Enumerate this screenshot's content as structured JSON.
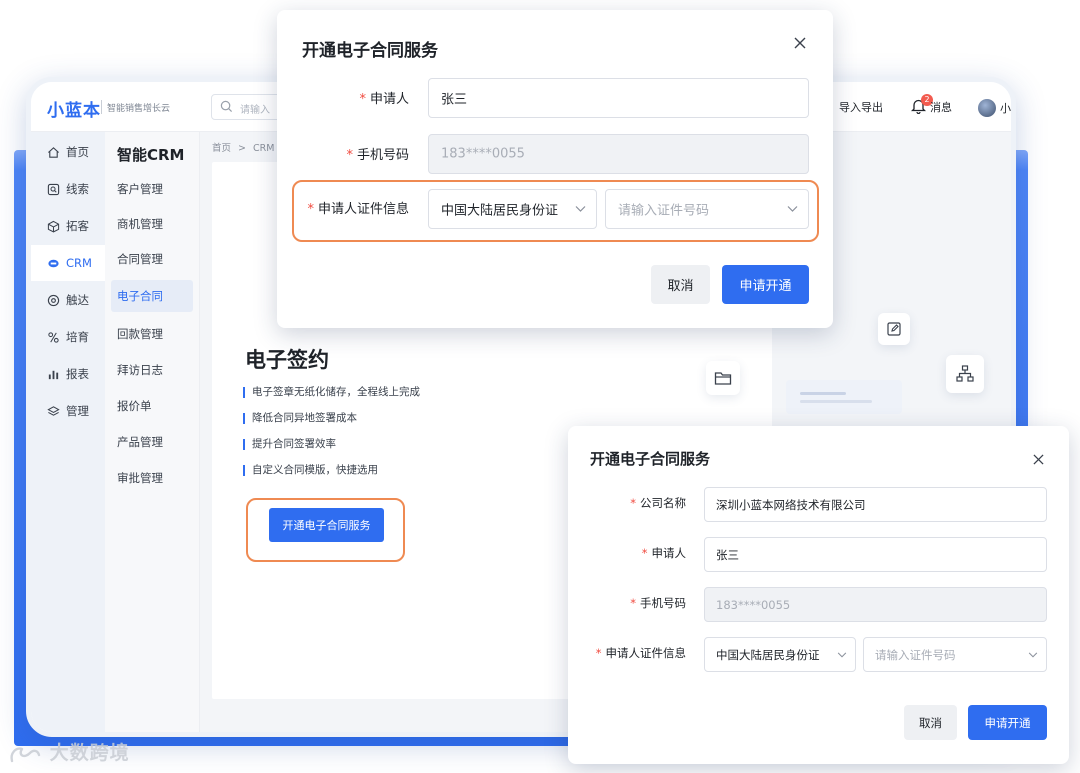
{
  "app": {
    "logo": "小蓝本",
    "tagline": "智能销售增长云"
  },
  "topbar": {
    "search_placeholder": "请输入",
    "import_export": "导入导出",
    "notification_count": "2",
    "messages": "消息",
    "user_initial": "小"
  },
  "sidebar": {
    "items": [
      {
        "label": "首页",
        "icon": "home-icon"
      },
      {
        "label": "线索",
        "icon": "clue-icon"
      },
      {
        "label": "拓客",
        "icon": "cube-icon"
      },
      {
        "label": "CRM",
        "icon": "crm-icon"
      },
      {
        "label": "触达",
        "icon": "reach-icon"
      },
      {
        "label": "培育",
        "icon": "nurture-icon"
      },
      {
        "label": "报表",
        "icon": "bar-chart-icon"
      },
      {
        "label": "管理",
        "icon": "layers-icon"
      }
    ],
    "active_index": 3
  },
  "subnav": {
    "title": "智能CRM",
    "items": [
      "客户管理",
      "商机管理",
      "合同管理",
      "电子合同",
      "回款管理",
      "拜访日志",
      "报价单",
      "产品管理",
      "审批管理"
    ],
    "active_index": 3
  },
  "breadcrumb": {
    "home": "首页",
    "separator": ">",
    "current": "CRM"
  },
  "hero": {
    "title": "电子签约",
    "features": [
      "电子签章无纸化储存，全程线上完成",
      "降低合同异地签署成本",
      "提升合同签署效率",
      "自定义合同模版，快捷选用"
    ],
    "cta": "开通电子合同服务"
  },
  "dialog_top": {
    "title": "开通电子合同服务",
    "fields": {
      "applicant_label": "申请人",
      "applicant_value": "张三",
      "phone_label": "手机号码",
      "phone_value": "183****0055",
      "id_label": "申请人证件信息",
      "id_type": "中国大陆居民身份证",
      "id_placeholder": "请输入证件号码"
    },
    "cancel": "取消",
    "submit": "申请开通"
  },
  "dialog_bottom": {
    "title": "开通电子合同服务",
    "fields": {
      "company_label": "公司名称",
      "company_value": "深圳小蓝本网络技术有限公司",
      "applicant_label": "申请人",
      "applicant_value": "张三",
      "phone_label": "手机号码",
      "phone_value": "183****0055",
      "id_label": "申请人证件信息",
      "id_type": "中国大陆居民身份证",
      "id_placeholder": "请输入证件号码"
    },
    "cancel": "取消",
    "submit": "申请开通"
  },
  "watermark": "大数跨境",
  "colors": {
    "accent": "#2f6df0",
    "highlight": "#ef8a52",
    "required": "#f04a3f"
  }
}
